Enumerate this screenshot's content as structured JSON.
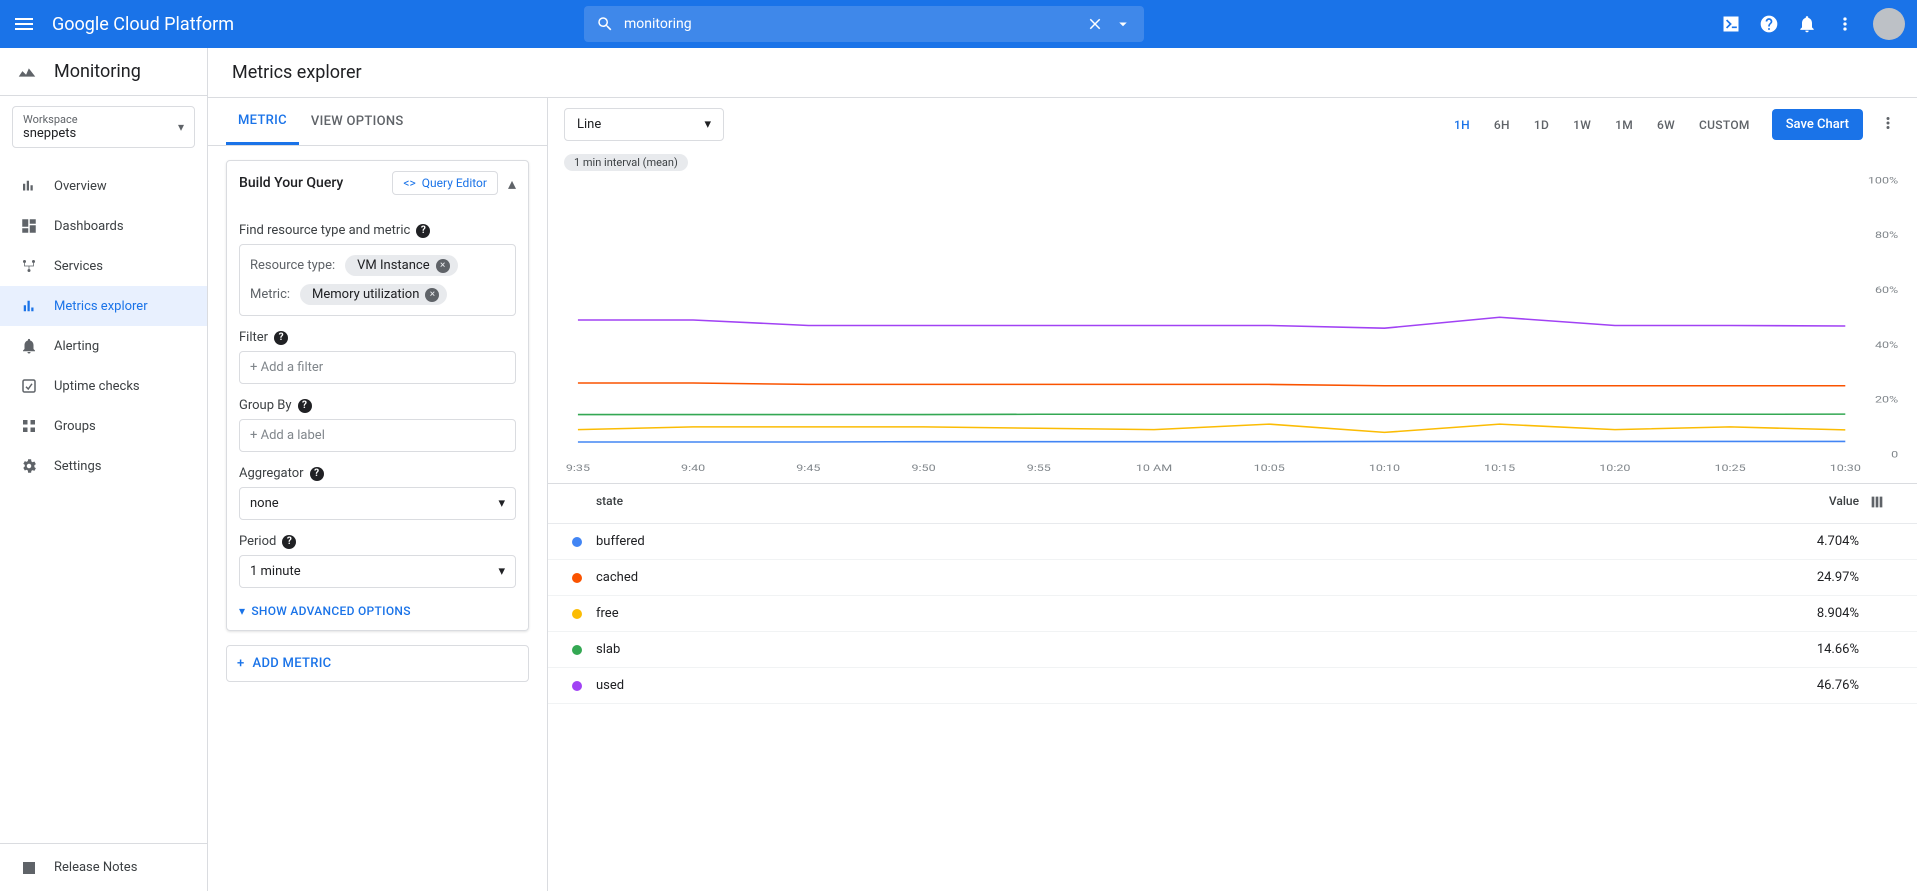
{
  "header": {
    "product": "Google Cloud Platform",
    "search_value": "monitoring"
  },
  "sidebar": {
    "title": "Monitoring",
    "workspace_label": "Workspace",
    "workspace_value": "sneppets",
    "items": [
      {
        "label": "Overview"
      },
      {
        "label": "Dashboards"
      },
      {
        "label": "Services"
      },
      {
        "label": "Metrics explorer"
      },
      {
        "label": "Alerting"
      },
      {
        "label": "Uptime checks"
      },
      {
        "label": "Groups"
      },
      {
        "label": "Settings"
      }
    ],
    "release_notes": "Release Notes"
  },
  "main": {
    "title": "Metrics explorer",
    "tabs": {
      "metric": "Metric",
      "view": "View Options"
    },
    "build_title": "Build Your Query",
    "query_editor": "Query Editor",
    "find_label": "Find resource type and metric",
    "resource_type_label": "Resource type:",
    "resource_type_value": "VM Instance",
    "metric_label": "Metric:",
    "metric_value": "Memory utilization",
    "filter_label": "Filter",
    "filter_placeholder": "+ Add a filter",
    "groupby_label": "Group By",
    "groupby_placeholder": "+ Add a label",
    "aggregator_label": "Aggregator",
    "aggregator_value": "none",
    "period_label": "Period",
    "period_value": "1 minute",
    "advanced": "Show Advanced Options",
    "add_metric": "Add Metric"
  },
  "chart": {
    "type": "Line",
    "time_ranges": [
      "1H",
      "6H",
      "1D",
      "1W",
      "1M",
      "6W",
      "CUSTOM"
    ],
    "active_range": "1H",
    "save_chart": "Save Chart",
    "interval": "1 min interval (mean)",
    "legend_header_state": "state",
    "legend_header_value": "Value",
    "legend": [
      {
        "state": "buffered",
        "value": "4.704%",
        "color": "#4285f4"
      },
      {
        "state": "cached",
        "value": "24.97%",
        "color": "#fa5300"
      },
      {
        "state": "free",
        "value": "8.904%",
        "color": "#fbbc04"
      },
      {
        "state": "slab",
        "value": "14.66%",
        "color": "#34a853"
      },
      {
        "state": "used",
        "value": "46.76%",
        "color": "#a142f4"
      }
    ]
  },
  "chart_data": {
    "type": "line",
    "title": "",
    "xlabel": "",
    "ylabel": "",
    "ylim": [
      0,
      100
    ],
    "y_ticks": [
      "0",
      "20%",
      "40%",
      "60%",
      "80%",
      "100%"
    ],
    "x_ticks": [
      "9:35",
      "9:40",
      "9:45",
      "9:50",
      "9:55",
      "10 AM",
      "10:05",
      "10:10",
      "10:15",
      "10:20",
      "10:25",
      "10:30"
    ],
    "series": [
      {
        "name": "buffered",
        "color": "#4285f4",
        "values": [
          4.5,
          4.5,
          4.5,
          4.6,
          4.6,
          4.6,
          4.6,
          4.7,
          4.7,
          4.7,
          4.7,
          4.7
        ]
      },
      {
        "name": "cached",
        "color": "#fa5300",
        "values": [
          26,
          26,
          25.5,
          25.5,
          25.5,
          25.5,
          25.5,
          25,
          25,
          25,
          25,
          25
        ]
      },
      {
        "name": "free",
        "color": "#fbbc04",
        "values": [
          9,
          10,
          10,
          10,
          9.5,
          9,
          11,
          8,
          11,
          9,
          10,
          8.9
        ]
      },
      {
        "name": "slab",
        "color": "#34a853",
        "values": [
          14.5,
          14.5,
          14.5,
          14.5,
          14.6,
          14.6,
          14.6,
          14.6,
          14.6,
          14.6,
          14.6,
          14.66
        ]
      },
      {
        "name": "used",
        "color": "#a142f4",
        "values": [
          49,
          49,
          47,
          47,
          47,
          47,
          47,
          46,
          50,
          47,
          47,
          46.8
        ]
      }
    ]
  }
}
